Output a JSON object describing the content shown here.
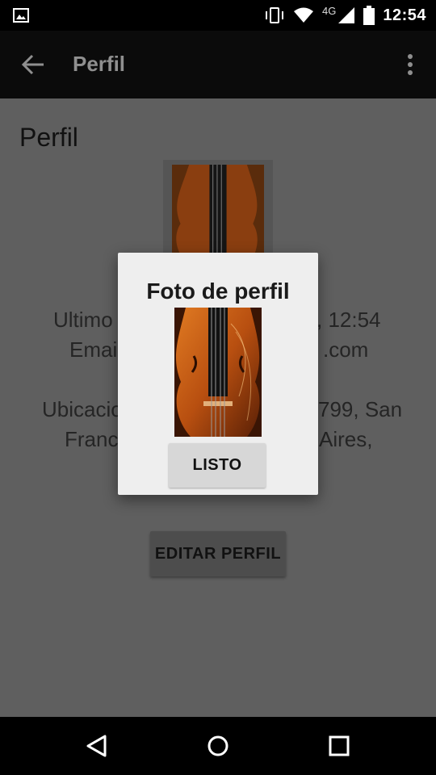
{
  "status_bar": {
    "time": "12:54",
    "network": "4G",
    "icons": [
      "gallery-icon",
      "vibrate-icon",
      "wifi-icon",
      "signal-icon",
      "battery-icon"
    ]
  },
  "app_bar": {
    "title": "Perfil",
    "back_icon": "arrow-back-icon",
    "menu_icon": "more-vert-icon"
  },
  "profile": {
    "heading": "Perfil",
    "last_seen_visible": "Ultimo",
    "last_seen_tail": ", 12:54",
    "email_visible": "Emai",
    "email_tail": ".com",
    "location_line1_start": "Ubicacio",
    "location_line1_end": "799, San",
    "location_line2_start": "Franc",
    "location_line2_end": "Aires,",
    "edit_button": "EDITAR PERFIL"
  },
  "dialog": {
    "title": "Foto de perfil",
    "ok_button": "LISTO",
    "image": "violin-photo"
  },
  "nav_bar": {
    "icons": [
      "back-triangle-icon",
      "home-circle-icon",
      "recents-square-icon"
    ]
  },
  "colors": {
    "scrim": "#5f5f5f",
    "dialog_bg": "#eeeeee",
    "appbar": "#0b0b0b",
    "violin": "#c4621a"
  }
}
